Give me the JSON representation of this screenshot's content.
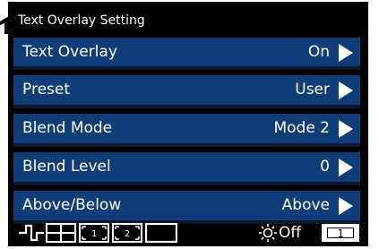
{
  "osd": {
    "title": "Text Overlay Setting",
    "menu": [
      {
        "label": "Text Overlay",
        "value": "On"
      },
      {
        "label": "Preset",
        "value": "User"
      },
      {
        "label": "Blend Mode",
        "value": "Mode 2"
      },
      {
        "label": "Blend Level",
        "value": "0"
      },
      {
        "label": "Above/Below",
        "value": "Above"
      }
    ],
    "status": {
      "brightness_label": "Off",
      "channel_number": "1",
      "icons": [
        "waveform-icon",
        "split-screen-icon",
        "marker-1-icon",
        "marker-2-icon",
        "blank-frame-icon"
      ]
    }
  },
  "colors": {
    "background": "#000000",
    "row_fill": "#0f3d78",
    "text": "#ffffff"
  }
}
